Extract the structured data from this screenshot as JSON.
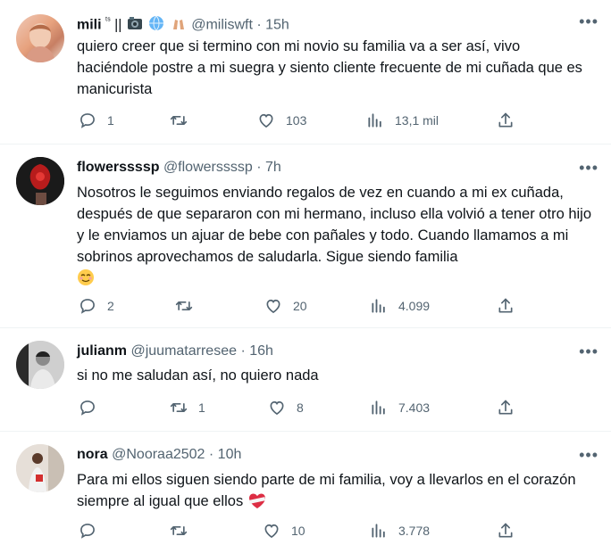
{
  "tweets": [
    {
      "name": "mili",
      "name_badge": "ᵗˢ",
      "name_extra": "||",
      "handle": "@miliswft",
      "dot": "·",
      "time": "15h",
      "text": "quiero creer que si termino con mi novio su familia va a ser así, vivo haciéndole postre a mi suegra y siento cliente frecuente de mi cuñada que es manicurista",
      "replies": "1",
      "retweets": "",
      "likes": "103",
      "views": "13,1 mil"
    },
    {
      "name": "flowerssssp",
      "handle": "@flowerssssp",
      "dot": "·",
      "time": "7h",
      "text": "Nosotros le seguimos enviando regalos de vez en cuando a mi ex cuñada, después de que separaron con mi hermano, incluso ella volvió a tener otro hijo y le enviamos un ajuar de bebe con pañales y todo. Cuando llamamos a mi sobrinos aprovechamos de saludarla. Sigue siendo familia",
      "replies": "2",
      "retweets": "",
      "likes": "20",
      "views": "4.099"
    },
    {
      "name": "julianm",
      "handle": "@juumatarresee",
      "dot": "·",
      "time": "16h",
      "text": "si no me saludan así, no quiero nada",
      "replies": "",
      "retweets": "1",
      "likes": "8",
      "views": "7.403"
    },
    {
      "name": "nora",
      "handle": "@Nooraa2502",
      "dot": "·",
      "time": "10h",
      "text": "Para mi ellos siguen siendo parte de mi familia, voy a llevarlos en el corazón siempre al igual que ellos",
      "replies": "",
      "retweets": "",
      "likes": "10",
      "views": "3.778"
    }
  ],
  "more_label": "•••",
  "colors": {
    "muted": "#536471",
    "text": "#0f1419",
    "divider": "#eff3f4"
  },
  "icons": [
    "reply-icon",
    "retweet-icon",
    "like-icon",
    "views-icon",
    "share-icon",
    "more-icon"
  ]
}
